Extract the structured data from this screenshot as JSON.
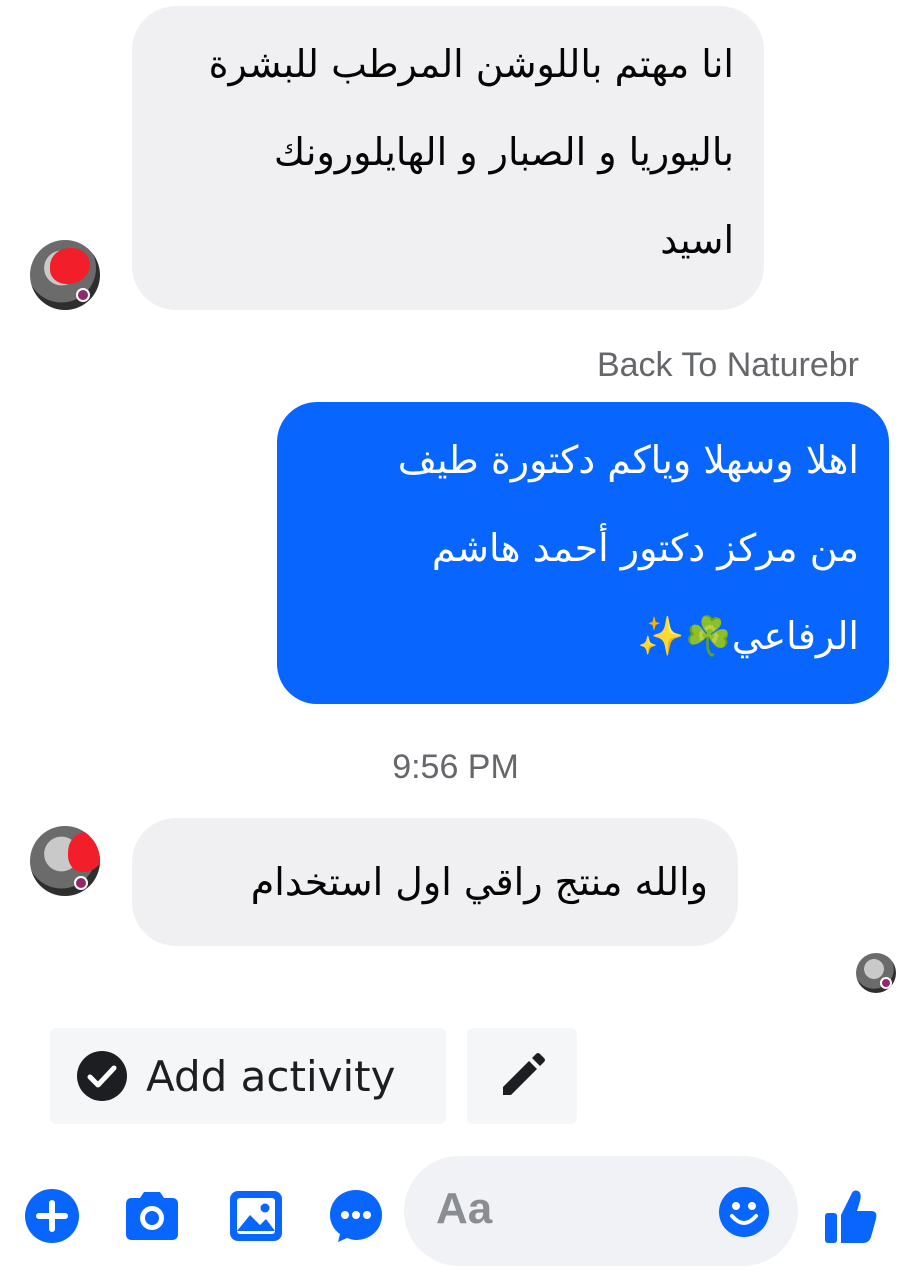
{
  "messages": [
    {
      "direction": "incoming",
      "lines": [
        "انا مهتم باللوشن المرطب للبشرة",
        "باليوريا و الصبار و الهايلورونك",
        "اسيد"
      ]
    },
    {
      "direction": "outgoing",
      "sender": "Back To Naturebr",
      "lines": [
        "اهلا وسهلا وياكم دكتورة طيف",
        "من مركز دكتور أحمد هاشم",
        "الرفاعي☘️✨"
      ]
    },
    {
      "direction": "incoming",
      "time_separator": "9:56 PM",
      "lines": [
        "والله منتج راقي اول استخدام"
      ]
    }
  ],
  "actions": {
    "add_activity_label": "Add activity"
  },
  "composer": {
    "placeholder": "Aa"
  },
  "colors": {
    "accent": "#0866ff",
    "incoming_bubble": "#f0f0f2",
    "meta_text": "#65676b",
    "redaction": "#f21f2a"
  }
}
